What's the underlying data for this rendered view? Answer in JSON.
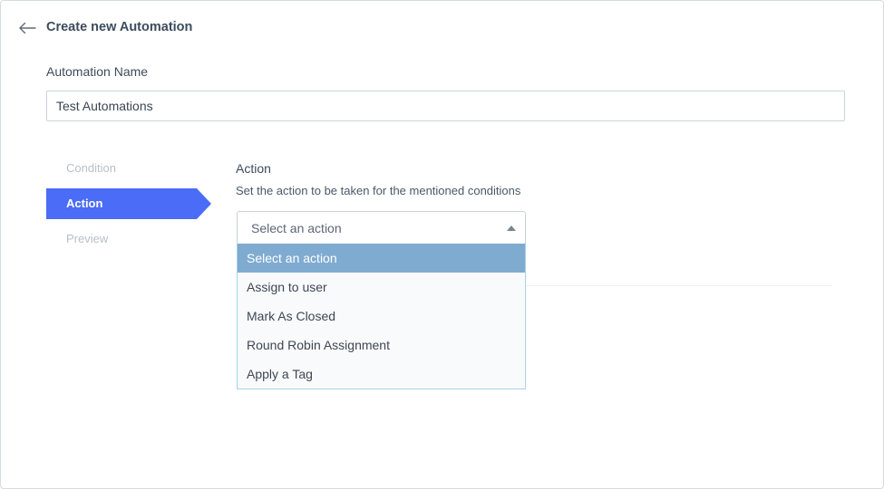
{
  "header": {
    "title": "Create new Automation",
    "back_icon": "arrow-left-icon"
  },
  "automation_name": {
    "label": "Automation Name",
    "value": "Test Automations"
  },
  "steps": [
    {
      "label": "Condition",
      "active": false
    },
    {
      "label": "Action",
      "active": true
    },
    {
      "label": "Preview",
      "active": false
    }
  ],
  "action_section": {
    "title": "Action",
    "description": "Set the action to be taken for the mentioned conditions",
    "select": {
      "value": "Select an action",
      "options": [
        "Select an action",
        "Assign to user",
        "Mark As Closed",
        "Round Robin Assignment",
        "Apply a Tag"
      ],
      "highlighted_index": 0
    }
  },
  "colors": {
    "active_step": "#4a6cf7",
    "option_highlight": "#7fabd1",
    "dropdown_border": "#a8d4e8"
  }
}
